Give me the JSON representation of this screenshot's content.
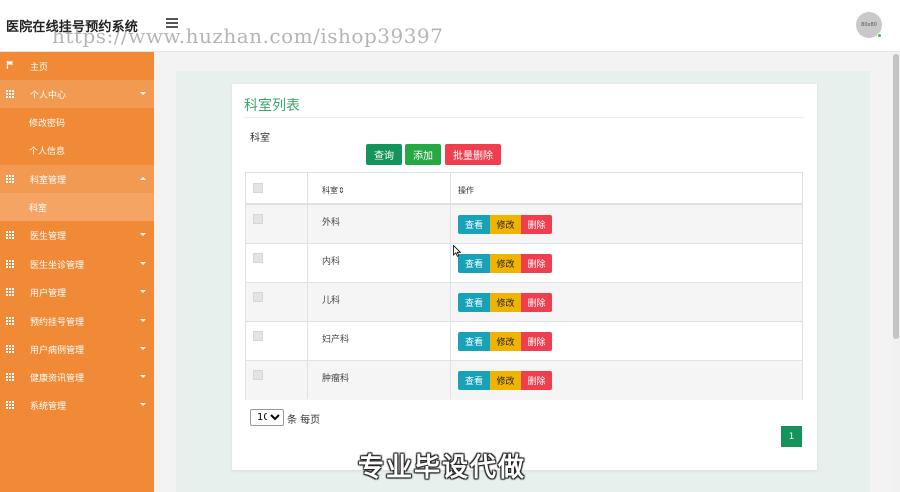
{
  "header": {
    "app_title": "医院在线挂号预约系统",
    "watermark": "https://www.huzhan.com/ishop39397",
    "avatar_text": "80x80"
  },
  "sidebar": {
    "items": [
      {
        "label": "主页",
        "icon": "flag-icon"
      },
      {
        "label": "个人中心",
        "icon": "grid-icon",
        "expanded": true
      },
      {
        "label": "修改密码",
        "sub": true
      },
      {
        "label": "个人信息",
        "sub": true
      },
      {
        "label": "科室管理",
        "icon": "grid-icon",
        "expanded": true
      },
      {
        "label": "科室",
        "sub": true,
        "active": true
      },
      {
        "label": "医生管理",
        "icon": "grid-icon"
      },
      {
        "label": "医生坐诊管理",
        "icon": "grid-icon"
      },
      {
        "label": "用户管理",
        "icon": "grid-icon"
      },
      {
        "label": "预约挂号管理",
        "icon": "grid-icon"
      },
      {
        "label": "用户病例管理",
        "icon": "grid-icon"
      },
      {
        "label": "健康资讯管理",
        "icon": "grid-icon"
      },
      {
        "label": "系统管理",
        "icon": "grid-icon"
      }
    ]
  },
  "main": {
    "title": "科室列表",
    "filter": {
      "label": "科室",
      "value": "",
      "placeholder": ""
    },
    "buttons": {
      "query": "查询",
      "add": "添加",
      "batch_delete": "批量删除"
    },
    "table": {
      "headers": {
        "name": "科室⇕",
        "actions": "操作"
      },
      "rows": [
        {
          "name": "外科"
        },
        {
          "name": "内科"
        },
        {
          "name": "儿科"
        },
        {
          "name": "妇产科"
        },
        {
          "name": "肿瘤科"
        }
      ],
      "row_actions": {
        "view": "查看",
        "edit": "修改",
        "delete": "删除"
      }
    },
    "pagination": {
      "page_size": "10",
      "page_size_suffix": "条 每页",
      "current_page": "1"
    }
  },
  "overlay": {
    "slogan": "专业毕设代做"
  },
  "colors": {
    "sidebar": "#f08a37",
    "title": "#3aaa6b",
    "primary": "#15935c",
    "success": "#28a745",
    "danger": "#ef3e4d",
    "info": "#17a2b8",
    "warning": "#f0b400"
  }
}
